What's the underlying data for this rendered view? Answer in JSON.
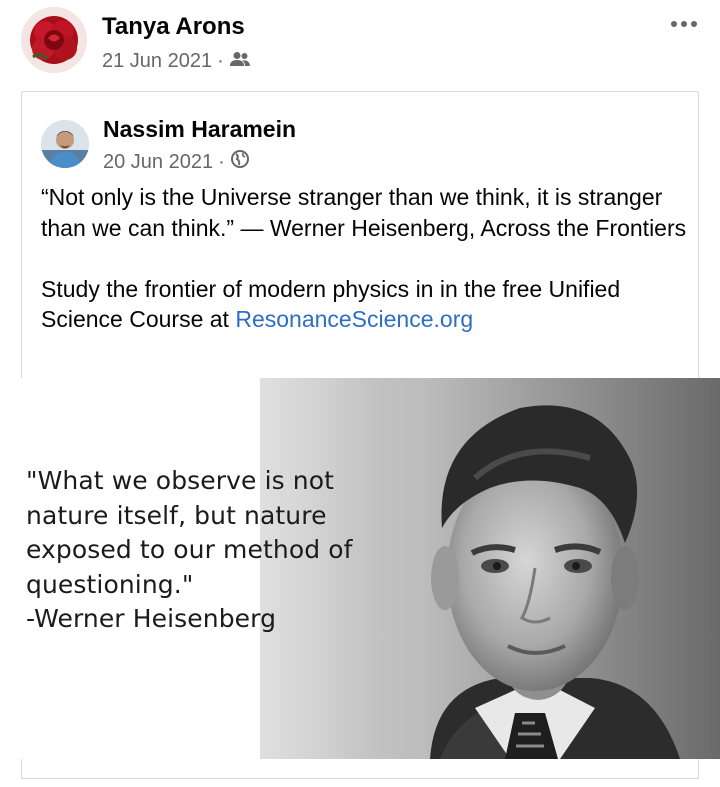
{
  "post": {
    "author": "Tanya Arons",
    "date": "21 Jun 2021",
    "separator": "·",
    "audience_icon": "friends-icon",
    "more_icon": "more-options-icon"
  },
  "shared_post": {
    "author": "Nassim Haramein",
    "date": "20 Jun 2021",
    "separator": "·",
    "audience_icon": "globe-icon",
    "text_paragraph_1": "“Not only is the Universe stranger than we think, it is stranger than we can think.” — Werner Heisenberg, Across the Frontiers",
    "text_paragraph_2_prefix": "Study the frontier of modern physics in in the free Unified Science Course at ",
    "link_text": "ResonanceScience.org",
    "link_color": "#2d6ec5"
  },
  "image": {
    "quote_lines": [
      "\"What we observe is not",
      "nature itself, but nature",
      "exposed to our method of",
      "questioning.\"",
      "-Werner Heisenberg"
    ]
  }
}
